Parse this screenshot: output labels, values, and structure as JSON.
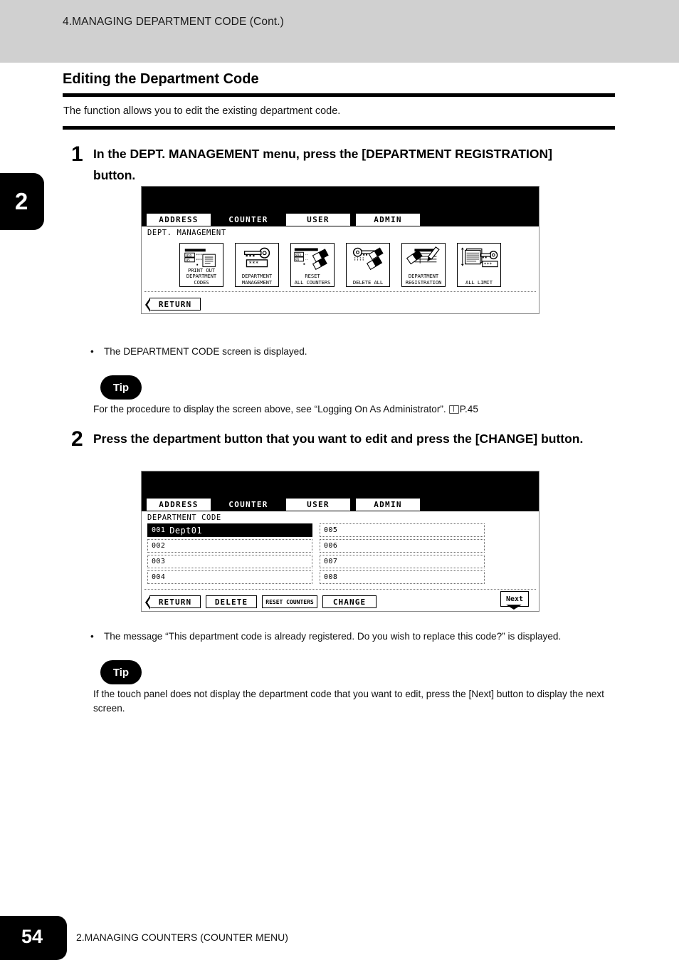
{
  "running_head": "4.MANAGING DEPARTMENT CODE (Cont.)",
  "chapter_tab": "2",
  "section": {
    "title": "Editing the Department Code",
    "lead": "The function allows you to edit the existing department code."
  },
  "steps": [
    {
      "number": "1",
      "text": "In the DEPT. MANAGEMENT menu, press the [DEPARTMENT REGISTRATION] button.",
      "note_bullet": "•",
      "note": "The DEPARTMENT CODE screen is displayed.",
      "tip_label": "Tip",
      "tip_text_before": "For the procedure to display the screen above, see “Logging On As Administrator”.",
      "tip_ref": "P.45"
    },
    {
      "number": "2",
      "text": "Press the department button that you want to edit and press the [CHANGE] button.",
      "note_bullet": "•",
      "note": "The message “This department code is already registered.  Do you wish to replace this code?” is displayed.",
      "tip_label": "Tip",
      "tip_text": "If the touch panel does not display the department code that you want to edit, press the [Next] button to display the next screen."
    }
  ],
  "panel1": {
    "tabs": [
      {
        "label": "ADDRESS",
        "selected": false
      },
      {
        "label": "COUNTER",
        "selected": true
      },
      {
        "label": "USER",
        "selected": false
      },
      {
        "label": "ADMIN",
        "selected": false
      }
    ],
    "caption": "DEPT.  MANAGEMENT",
    "icons": [
      {
        "name": "print-out-department-codes-icon",
        "label": "PRINT OUT\nDEPARTMENT CODES"
      },
      {
        "name": "department-management-icon",
        "label": "DEPARTMENT\nMANAGEMENT"
      },
      {
        "name": "reset-all-counters-icon",
        "label": "RESET\nALL COUNTERS"
      },
      {
        "name": "delete-all-icon",
        "label": "DELETE ALL"
      },
      {
        "name": "department-registration-icon",
        "label": "DEPARTMENT\nREGISTRATION"
      },
      {
        "name": "all-limit-icon",
        "label": "ALL LIMIT"
      }
    ],
    "return_label": "RETURN"
  },
  "panel2": {
    "tabs": [
      {
        "label": "ADDRESS",
        "selected": false
      },
      {
        "label": "COUNTER",
        "selected": true
      },
      {
        "label": "USER",
        "selected": false
      },
      {
        "label": "ADMIN",
        "selected": false
      }
    ],
    "caption": "DEPARTMENT CODE",
    "left_column": [
      {
        "num": "001",
        "name": "Dept01",
        "selected": true
      },
      {
        "num": "002",
        "name": "",
        "selected": false
      },
      {
        "num": "003",
        "name": "",
        "selected": false
      },
      {
        "num": "004",
        "name": "",
        "selected": false
      }
    ],
    "right_column": [
      {
        "num": "005",
        "name": "",
        "selected": false
      },
      {
        "num": "006",
        "name": "",
        "selected": false
      },
      {
        "num": "007",
        "name": "",
        "selected": false
      },
      {
        "num": "008",
        "name": "",
        "selected": false
      }
    ],
    "buttons": {
      "return_label": "RETURN",
      "delete_label": "DELETE",
      "reset_counters_label": "RESET COUNTERS",
      "change_label": "CHANGE",
      "next_label": "Next"
    }
  },
  "footer": {
    "page_number": "54",
    "text": "2.MANAGING COUNTERS (COUNTER MENU)"
  },
  "colors": {
    "header_band": "#d0d0d0",
    "rule": "#000000",
    "lcd_bezel": "#000000"
  }
}
